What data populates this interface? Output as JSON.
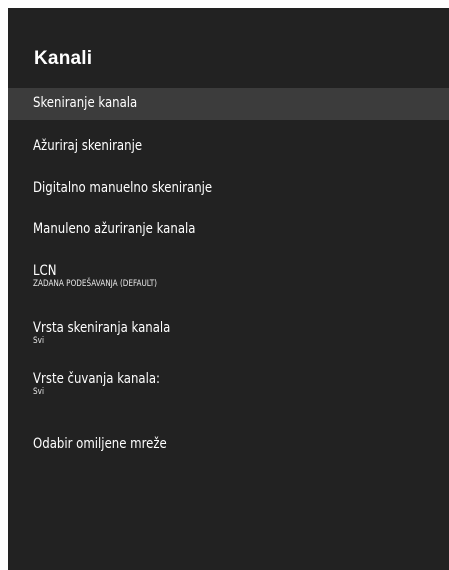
{
  "panel": {
    "title": "Kanali"
  },
  "menu": {
    "items": [
      {
        "label": "Skeniranje kanala",
        "selected": true
      },
      {
        "label": "Ažuriraj skeniranje"
      },
      {
        "label": "Digitalno manuelno skeniranje"
      },
      {
        "label": "Manuleno ažuriranje kanala"
      },
      {
        "label": "LCN",
        "value": "ZADANA PODEŠAVANJA (DEFAULT)"
      },
      {
        "label": "Vrsta skeniranja kanala",
        "value": "Svi"
      },
      {
        "label": "Vrste čuvanja kanala:",
        "value": "Svi"
      },
      {
        "label": "Odabir omiljene mreže"
      }
    ]
  },
  "colors": {
    "panel_bg": "#222222",
    "selected_bg": "#3c3c3c",
    "text": "#ffffff"
  }
}
